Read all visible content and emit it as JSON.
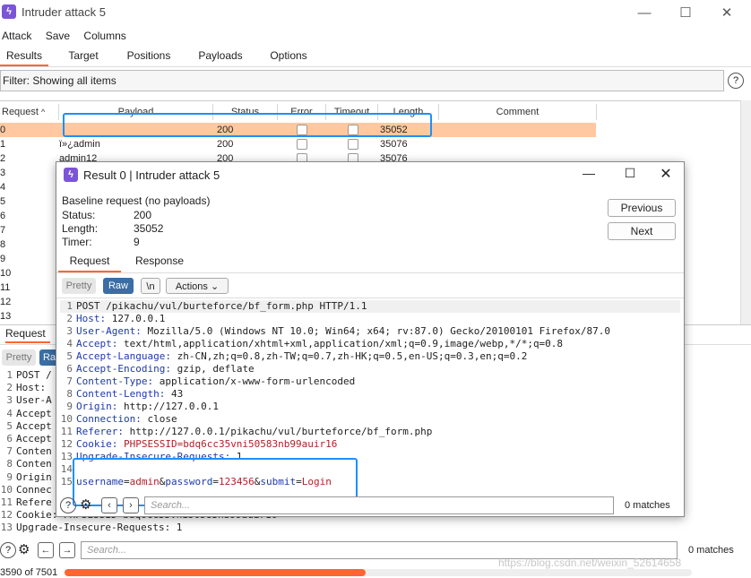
{
  "main_window": {
    "title": "Intruder attack 5",
    "menu": [
      "Attack",
      "Save",
      "Columns"
    ],
    "tabs": [
      "Results",
      "Target",
      "Positions",
      "Payloads",
      "Options"
    ],
    "filter_text": "Filter: Showing all items",
    "help_icon": "?"
  },
  "table": {
    "headers": [
      "Request",
      "Payload",
      "Status",
      "Error",
      "Timeout",
      "Length",
      "Comment"
    ],
    "rows": [
      {
        "request": "0",
        "payload": "",
        "status": "200",
        "length": "35052"
      },
      {
        "request": "1",
        "payload": "ï»¿admin",
        "status": "200",
        "length": "35076"
      },
      {
        "request": "2",
        "payload": "admin12",
        "status": "200",
        "length": "35076"
      },
      {
        "request": "3",
        "payload": "",
        "status": "",
        "length": ""
      },
      {
        "request": "4",
        "payload": "",
        "status": "",
        "length": ""
      },
      {
        "request": "5",
        "payload": "",
        "status": "",
        "length": ""
      },
      {
        "request": "6",
        "payload": "",
        "status": "",
        "length": ""
      },
      {
        "request": "7",
        "payload": "",
        "status": "",
        "length": ""
      },
      {
        "request": "8",
        "payload": "",
        "status": "",
        "length": ""
      },
      {
        "request": "9",
        "payload": "",
        "status": "",
        "length": ""
      },
      {
        "request": "10",
        "payload": "",
        "status": "",
        "length": ""
      },
      {
        "request": "11",
        "payload": "",
        "status": "",
        "length": ""
      },
      {
        "request": "12",
        "payload": "",
        "status": "",
        "length": ""
      },
      {
        "request": "13",
        "payload": "",
        "status": "",
        "length": ""
      }
    ]
  },
  "bottom_pane": {
    "tab_request": "Request",
    "pretty": "Pretty",
    "raw_short": "Ra",
    "lines": [
      "POST /",
      "Host: ",
      "User-A",
      "Accept",
      "Accept",
      "Accept",
      "Conten",
      "Conten",
      "Origin",
      "Connec",
      "Refere",
      "Cookie: PHPSESSID=bdq6cc35vni50583nb99auir16",
      "Upgrade-Insecure-Requests: 1"
    ],
    "search_placeholder": "Search...",
    "matches": "0 matches",
    "progress_text": "3590 of 7501",
    "progress_fraction": 0.48,
    "watermark": "https://blog.csdn.net/weixin_52614658"
  },
  "dialog": {
    "title": "Result 0 | Intruder attack 5",
    "baseline": "Baseline request (no payloads)",
    "fields": [
      {
        "label": "Status:",
        "value": "200"
      },
      {
        "label": "Length:",
        "value": "35052"
      },
      {
        "label": "Timer:",
        "value": "9"
      }
    ],
    "previous": "Previous",
    "next": "Next",
    "tab_request": "Request",
    "tab_response": "Response",
    "pretty": "Pretty",
    "raw": "Raw",
    "newline": "\\n",
    "actions": "Actions",
    "request_lines": [
      {
        "n": "1",
        "key": "POST /pikachu/vul/burteforce/bf_form.php HTTP/1.1",
        "val": ""
      },
      {
        "n": "2",
        "key": "Host:",
        "val": " 127.0.0.1"
      },
      {
        "n": "3",
        "key": "User-Agent:",
        "val": " Mozilla/5.0 (Windows NT 10.0; Win64; x64; rv:87.0) Gecko/20100101 Firefox/87.0"
      },
      {
        "n": "4",
        "key": "Accept:",
        "val": " text/html,application/xhtml+xml,application/xml;q=0.9,image/webp,*/*;q=0.8"
      },
      {
        "n": "5",
        "key": "Accept-Language:",
        "val": " zh-CN,zh;q=0.8,zh-TW;q=0.7,zh-HK;q=0.5,en-US;q=0.3,en;q=0.2"
      },
      {
        "n": "6",
        "key": "Accept-Encoding:",
        "val": " gzip, deflate"
      },
      {
        "n": "7",
        "key": "Content-Type:",
        "val": " application/x-www-form-urlencoded"
      },
      {
        "n": "8",
        "key": "Content-Length:",
        "val": " 43"
      },
      {
        "n": "9",
        "key": "Origin:",
        "val": " http://127.0.0.1"
      },
      {
        "n": "10",
        "key": "Connection:",
        "val": " close"
      },
      {
        "n": "11",
        "key": "Referer:",
        "val": " http://127.0.0.1/pikachu/vul/burteforce/bf_form.php"
      },
      {
        "n": "12",
        "key": "Cookie:",
        "val": " PHPSESSID=bdq6cc35vni50583nb99auir16"
      },
      {
        "n": "13",
        "key": "Upgrade-Insecure-Requests:",
        "val": " 1"
      },
      {
        "n": "14",
        "key": "",
        "val": ""
      }
    ],
    "body_line_number": "15",
    "body": {
      "k1": "username",
      "v1": "admin",
      "k2": "password",
      "v2": "123456",
      "k3": "submit",
      "v3": "Login"
    },
    "search_placeholder": "Search...",
    "matches": "0 matches"
  },
  "colors": {
    "accent": "#ff6633",
    "selected_row": "#ffc8a0",
    "highlight_box": "#1e90ff",
    "raw_button": "#3a6ea5"
  }
}
